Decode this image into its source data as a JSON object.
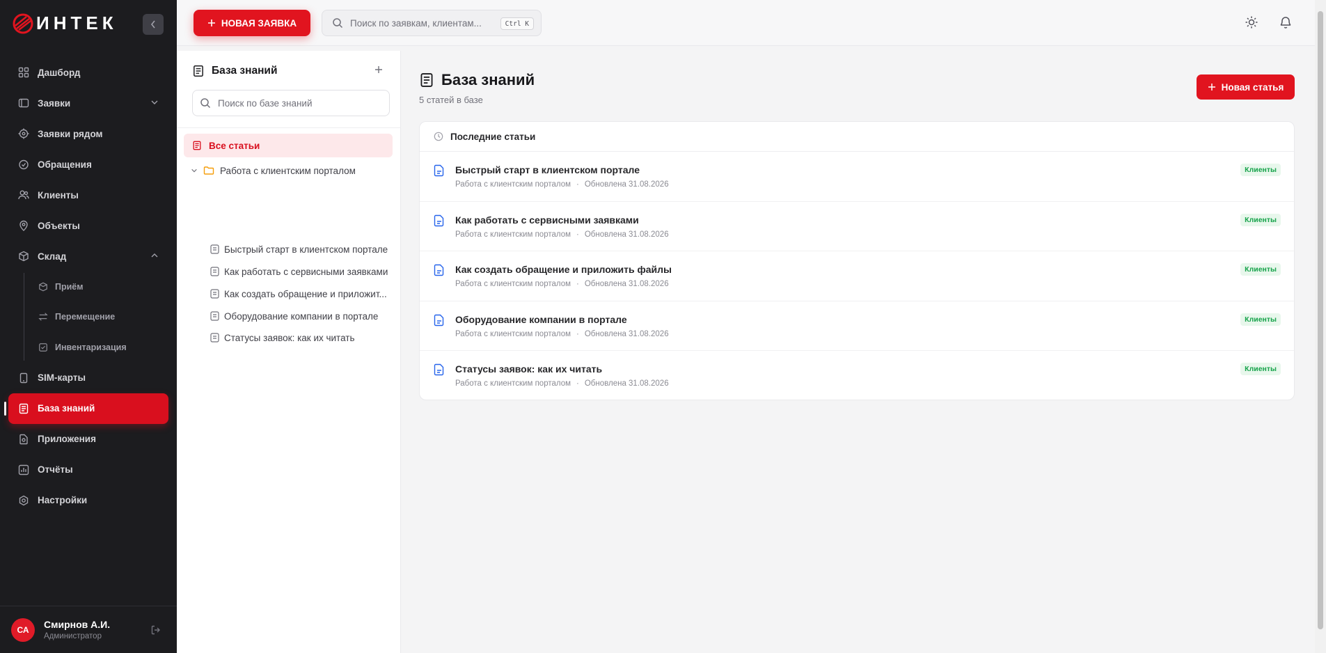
{
  "app": {
    "logo_text": "ИНТЕК"
  },
  "sidebar": {
    "items": [
      {
        "label": "Дашборд",
        "icon": "dashboard-icon"
      },
      {
        "label": "Заявки",
        "icon": "requests-icon"
      },
      {
        "label": "Заявки рядом",
        "icon": "target-icon"
      },
      {
        "label": "Обращения",
        "icon": "appeal-icon"
      },
      {
        "label": "Клиенты",
        "icon": "users-icon"
      },
      {
        "label": "Объекты",
        "icon": "location-icon"
      },
      {
        "label": "Склад",
        "icon": "box-icon"
      },
      {
        "label": "SIM-карты",
        "icon": "sim-icon"
      },
      {
        "label": "База знаний",
        "icon": "book-icon"
      },
      {
        "label": "Приложения",
        "icon": "app-icon"
      },
      {
        "label": "Отчёты",
        "icon": "chart-icon"
      },
      {
        "label": "Настройки",
        "icon": "gear-icon"
      }
    ],
    "warehouse_sub": [
      {
        "label": "Приём"
      },
      {
        "label": "Перемещение"
      },
      {
        "label": "Инвентаризация"
      }
    ],
    "active": "База знаний",
    "user": {
      "initials": "СА",
      "name": "Смирнов А.И.",
      "role": "Администратор"
    }
  },
  "topbar": {
    "new_request": "НОВАЯ ЗАЯВКА",
    "search_placeholder": "Поиск по заявкам, клиентам...",
    "shortcut": "Ctrl K"
  },
  "knowledge_panel": {
    "title": "База знаний",
    "search_placeholder": "Поиск по базе знаний",
    "all_articles": "Все статьи",
    "folder": "Работа с клиентским порталом",
    "articles": [
      "Быстрый старт в клиентском портале",
      "Как работать с сервисными заявками",
      "Как создать обращение и приложит...",
      "Оборудование компании в портале",
      "Статусы заявок: как их читать"
    ]
  },
  "main": {
    "title": "База знаний",
    "subtitle": "5 статей в базе",
    "new_article": "Новая статья",
    "recent_title": "Последние статьи",
    "rows": [
      {
        "title": "Быстрый старт в клиентском портале",
        "category": "Работа с клиентским порталом",
        "sep": "·",
        "updated": "Обновлена 31.08.2026",
        "badge": "Клиенты"
      },
      {
        "title": "Как работать с сервисными заявками",
        "category": "Работа с клиентским порталом",
        "sep": "·",
        "updated": "Обновлена 31.08.2026",
        "badge": "Клиенты"
      },
      {
        "title": "Как создать обращение и приложить файлы",
        "category": "Работа с клиентским порталом",
        "sep": "·",
        "updated": "Обновлена 31.08.2026",
        "badge": "Клиенты"
      },
      {
        "title": "Оборудование компании в портале",
        "category": "Работа с клиентским порталом",
        "sep": "·",
        "updated": "Обновлена 31.08.2026",
        "badge": "Клиенты"
      },
      {
        "title": "Статусы заявок: как их читать",
        "category": "Работа с клиентским порталом",
        "sep": "·",
        "updated": "Обновлена 31.08.2026",
        "badge": "Клиенты"
      }
    ]
  },
  "colors": {
    "accent": "#e1141f",
    "sidebar_bg": "#1c1c1f",
    "badge_green": "#16a34a"
  }
}
